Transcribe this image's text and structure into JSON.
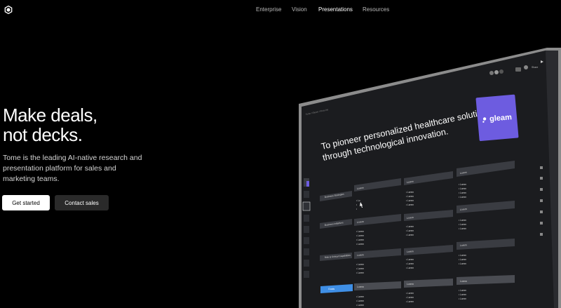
{
  "nav": {
    "items": [
      {
        "label": "Enterprise",
        "active": false
      },
      {
        "label": "Vision",
        "active": false
      },
      {
        "label": "Presentations",
        "active": true
      },
      {
        "label": "Resources",
        "active": false
      }
    ]
  },
  "hero": {
    "title_line1": "Make deals,",
    "title_line2": "not decks.",
    "subtitle": "Tome is the leading AI-native research and presentation platform for sales and marketing teams."
  },
  "buttons": {
    "primary": "Get started",
    "secondary": "Contact sales"
  },
  "device": {
    "toolbar_share": "Share",
    "breadcrumb": "Tome / Gleam / Proto list",
    "slide_heading_line1": "To pioneer personalized healthcare solutions",
    "slide_heading_line2": "through technological innovation.",
    "brand_logo_text": "gleam",
    "table": {
      "rows": [
        {
          "label": "Business Strategies",
          "col1": "Lorem",
          "col2": "Lorem",
          "col3": "Lorem"
        },
        {
          "label": "Business initiatives",
          "col1": "Lorem",
          "col2": "Lorem",
          "col3": "Lorem"
        },
        {
          "label": "Risk & Critical Capabilities",
          "col1": "Lorem",
          "col2": "Lorem",
          "col3": "Lorem"
        },
        {
          "label": "Goals",
          "col1": "Lorem",
          "col2": "Lorem",
          "col3": "Lorem"
        }
      ],
      "bullet": "Lorem"
    },
    "colors": {
      "screen_bg": "#1b1c1f",
      "cell_bg": "#3a3c42",
      "accent_purple": "#6d5ce0",
      "accent_blue": "#3f8fe6"
    }
  }
}
